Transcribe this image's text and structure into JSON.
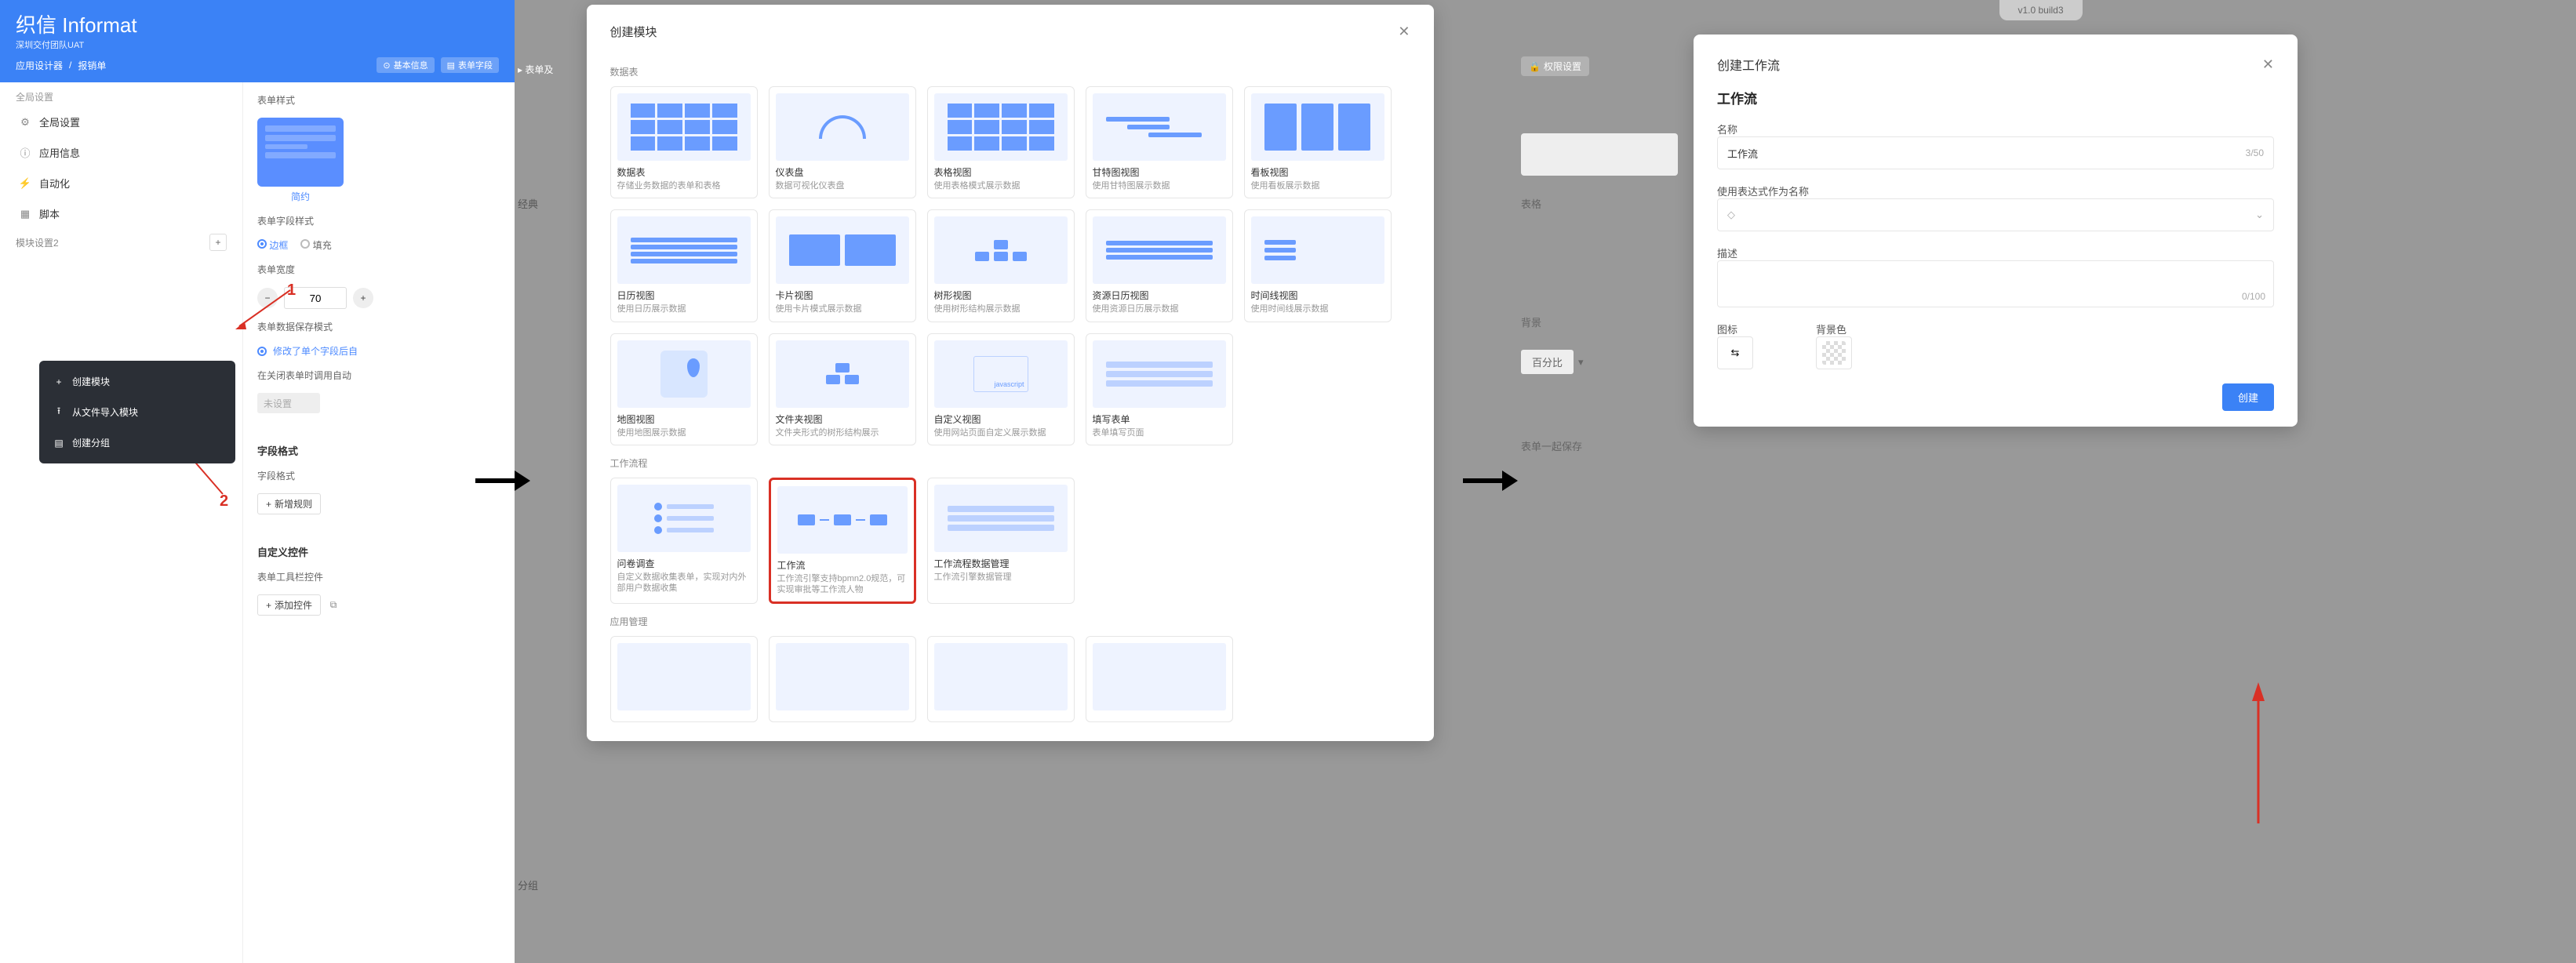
{
  "panel1": {
    "brand": "织信 Informat",
    "brand_sub": "深圳交付团队UAT",
    "crumb_a": "应用设计器",
    "crumb_b": "报销单",
    "tab_basic": "基本信息",
    "tab_fields": "表单字段",
    "global_title": "全局设置",
    "items": {
      "global": "全局设置",
      "appinfo": "应用信息",
      "auto": "自动化",
      "script": "脚本"
    },
    "module_label": "模块设置2",
    "ctx": {
      "create": "创建模块",
      "import": "从文件导入模块",
      "group": "创建分组"
    },
    "right": {
      "style_title": "表单样式",
      "style_name": "简约",
      "field_style_title": "表单字段样式",
      "radio_border": "边框",
      "radio_fill": "填充",
      "width_title": "表单宽度",
      "width_value": "70",
      "save_mode_title": "表单数据保存模式",
      "save_mode_opt": "修改了单个字段后自",
      "close_auto_title": "在关闭表单时调用自动",
      "unset": "未设置",
      "field_format_title": "字段格式",
      "field_format_sub": "字段格式",
      "add_rule": "新增规则",
      "custom_ctrl_title": "自定义控件",
      "toolbar_ctrl": "表单工具栏控件",
      "add_ctrl": "添加控件"
    },
    "annot": {
      "one": "1",
      "two": "2"
    }
  },
  "modal2": {
    "title": "创建模块",
    "group_data": "数据表",
    "group_flow": "工作流程",
    "group_app": "应用管理",
    "cards": {
      "data_table": {
        "name": "数据表",
        "desc": "存储业务数据的表单和表格"
      },
      "dashboard": {
        "name": "仪表盘",
        "desc": "数据可视化仪表盘"
      },
      "table_view": {
        "name": "表格视图",
        "desc": "使用表格模式展示数据"
      },
      "gantt": {
        "name": "甘特图视图",
        "desc": "使用甘特图展示数据"
      },
      "kanban": {
        "name": "看板视图",
        "desc": "使用看板展示数据"
      },
      "calendar": {
        "name": "日历视图",
        "desc": "使用日历展示数据"
      },
      "card": {
        "name": "卡片视图",
        "desc": "使用卡片模式展示数据"
      },
      "tree": {
        "name": "树形视图",
        "desc": "使用树形结构展示数据"
      },
      "res_cal": {
        "name": "资源日历视图",
        "desc": "使用资源日历展示数据"
      },
      "timeline": {
        "name": "时间线视图",
        "desc": "使用时间线展示数据"
      },
      "map": {
        "name": "地图视图",
        "desc": "使用地图展示数据"
      },
      "folder": {
        "name": "文件夹视图",
        "desc": "文件夹形式的树形结构展示"
      },
      "custom": {
        "name": "自定义视图",
        "desc": "使用网站页面自定义展示数据"
      },
      "fill_form": {
        "name": "填写表单",
        "desc": "表单填写页面"
      },
      "survey": {
        "name": "问卷调查",
        "desc": "自定义数据收集表单，实现对内外部用户数据收集"
      },
      "workflow": {
        "name": "工作流",
        "desc": "工作流引擎支持bpmn2.0规范，可实现审批等工作流人物"
      },
      "wf_data": {
        "name": "工作流程数据管理",
        "desc": "工作流引擎数据管理"
      }
    },
    "js_label": "javascript",
    "partial_bottom": "表单及"
  },
  "panel3": {
    "version": "v1.0 build3",
    "perm_tab": "权限设置",
    "hints": {
      "table": "表格",
      "bg": "背景",
      "pct": "百分比",
      "save": "表单一起保存"
    },
    "modal": {
      "title": "创建工作流",
      "subtitle": "工作流",
      "name_label": "名称",
      "name_value": "工作流",
      "name_counter": "3/50",
      "expr_label": "使用表达式作为名称",
      "expr_placeholder": "◇",
      "desc_label": "描述",
      "desc_counter": "0/100",
      "icon_label": "图标",
      "bg_label": "背景色",
      "submit": "创建"
    }
  }
}
